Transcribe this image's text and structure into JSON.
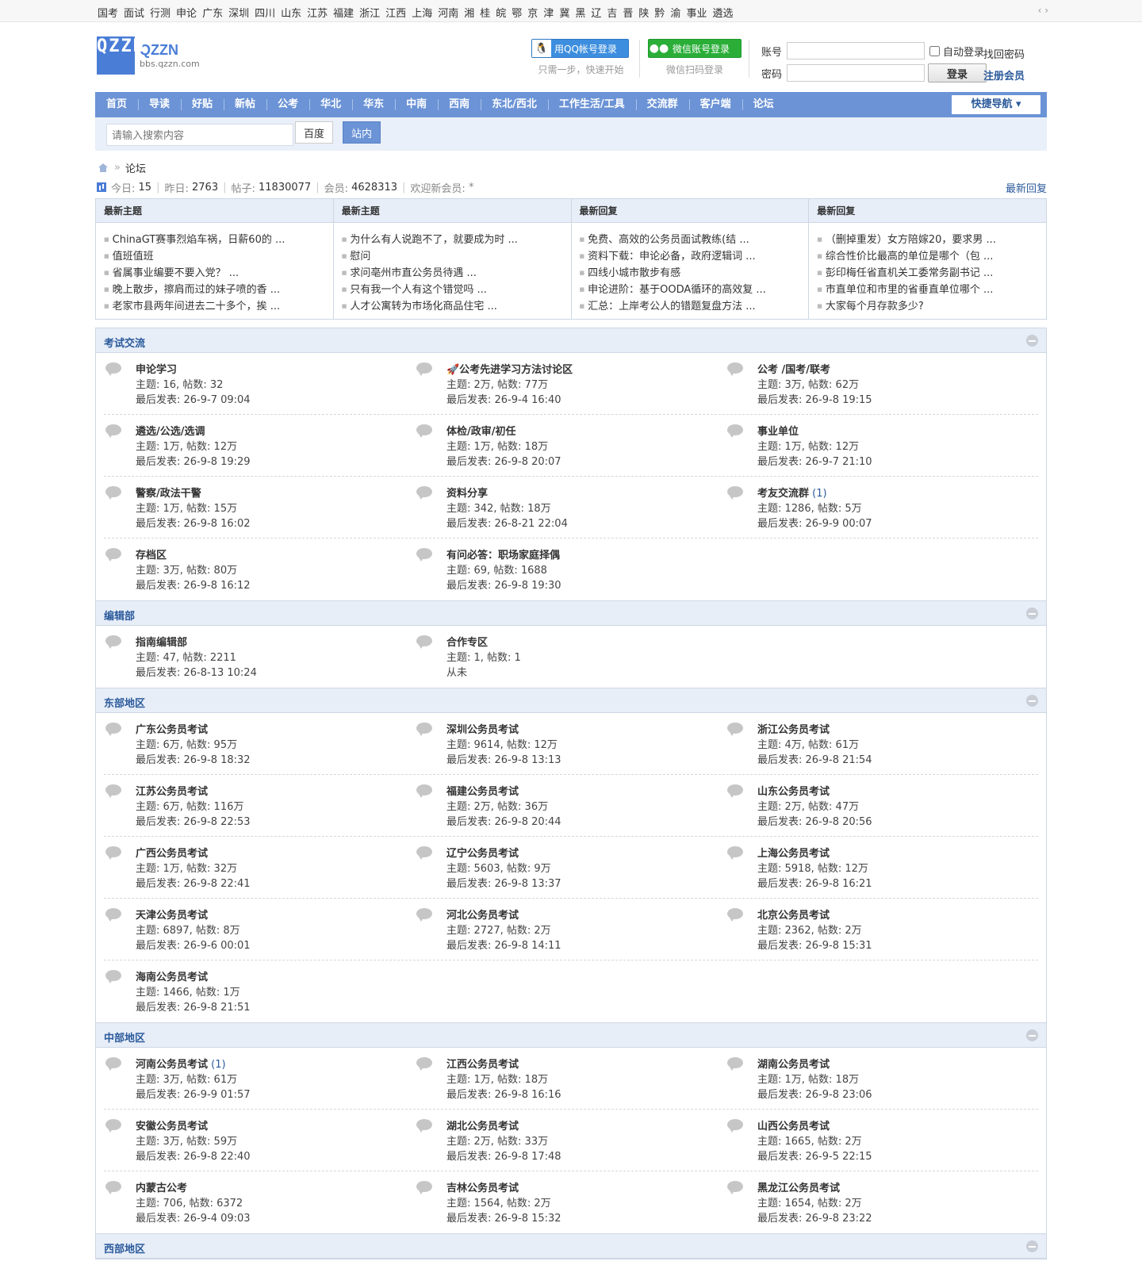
{
  "topbar": {
    "regions": [
      "国考",
      "面试",
      "行测",
      "申论",
      "广东",
      "深圳",
      "四川",
      "山东",
      "江苏",
      "福建",
      "浙江",
      "江西",
      "上海",
      "河南",
      "湘",
      "桂",
      "皖",
      "鄂",
      "京",
      "津",
      "冀",
      "黑",
      "辽",
      "吉",
      "晋",
      "陕",
      "黔",
      "渝",
      "事业",
      "遴选"
    ],
    "arrows": "‹ ›"
  },
  "header": {
    "logo_mark": "QZZN",
    "logo_title": "QZZN",
    "logo_url": "bbs.qzzn.com",
    "qq_button": "用QQ帐号登录",
    "qq_sub": "只需一步，快速开始",
    "wx_button": "微信账号登录",
    "wx_sub": "微信扫码登录",
    "account_label": "账号",
    "password_label": "密码",
    "auto_login": "自动登录",
    "login_button": "登录",
    "find_password": "找回密码",
    "register": "注册会员"
  },
  "nav": {
    "items": [
      "首页",
      "导读",
      "好贴",
      "新帖",
      "公考",
      "华北",
      "华东",
      "中南",
      "西南",
      "东北/西北",
      "工作生活/工具",
      "交流群",
      "客户端",
      "论坛"
    ],
    "quick_nav": "快捷导航"
  },
  "search": {
    "placeholder": "请输入搜索内容",
    "baidu": "百度",
    "site": "站内"
  },
  "breadcrumb": {
    "current": "论坛"
  },
  "stats": {
    "today_label": "今日:",
    "today": "15",
    "yesterday_label": "昨日:",
    "yesterday": "2763",
    "posts_label": "帖子:",
    "posts": "11830077",
    "members_label": "会员:",
    "members": "4628313",
    "welcome_label": "欢迎新会员:",
    "welcome": "*",
    "latest_reply": "最新回复"
  },
  "hot": [
    {
      "title": "最新主题",
      "items": [
        "ChinaGT赛事烈焰车祸，日薪60的 ...",
        "值班值班",
        "省属事业编要不要入党？ ...",
        "晚上散步，擦肩而过的妹子喷的香 ...",
        "老家市县两年间进去二十多个，挨 ..."
      ]
    },
    {
      "title": "最新主题",
      "items": [
        "为什么有人说跑不了，就要成为时 ...",
        "慰问",
        "求问亳州市直公务员待遇 ...",
        "只有我一个人有这个错觉吗 ...",
        "人才公寓转为市场化商品住宅 ..."
      ]
    },
    {
      "title": "最新回复",
      "items": [
        "免费、高效的公务员面试教练(结 ...",
        "资料下载：申论必备，政府逻辑词 ...",
        "四线小城市散步有感",
        "申论进阶：基于OODA循环的高效复 ...",
        "汇总：上岸考公人的错题复盘方法 ..."
      ]
    },
    {
      "title": "最新回复",
      "items": [
        "（删掉重发）女方陪嫁20，要求男 ...",
        "综合性价比最高的单位是哪个（包 ...",
        "彭印梅任省直机关工委常务副书记 ...",
        "市直单位和市里的省垂直单位哪个 ...",
        "大家每个月存款多少?"
      ]
    }
  ],
  "groups": [
    {
      "title": "考试交流",
      "rows": [
        [
          {
            "name": "申论学习",
            "count": "",
            "topics": "主题: 16, 帖数: 32",
            "last": "最后发表: 26-9-7 09:04"
          },
          {
            "name": "🚀公考先进学习方法讨论区",
            "count": "",
            "topics": "主题: 2万, 帖数: 77万",
            "last": "最后发表: 26-9-4 16:40"
          },
          {
            "name": "公考 /国考/联考",
            "count": "",
            "topics": "主题: 3万, 帖数: 62万",
            "last": "最后发表: 26-9-8 19:15"
          }
        ],
        [
          {
            "name": "遴选/公选/选调",
            "count": "",
            "topics": "主题: 1万, 帖数: 12万",
            "last": "最后发表: 26-9-8 19:29"
          },
          {
            "name": "体检/政审/初任",
            "count": "",
            "topics": "主题: 1万, 帖数: 18万",
            "last": "最后发表: 26-9-8 20:07"
          },
          {
            "name": "事业单位",
            "count": "",
            "topics": "主题: 1万, 帖数: 12万",
            "last": "最后发表: 26-9-7 21:10"
          }
        ],
        [
          {
            "name": "警察/政法干警",
            "count": "",
            "topics": "主题: 1万, 帖数: 15万",
            "last": "最后发表: 26-9-8 16:02"
          },
          {
            "name": "资料分享",
            "count": "",
            "topics": "主题: 342, 帖数: 18万",
            "last": "最后发表: 26-8-21 22:04"
          },
          {
            "name": "考友交流群",
            "count": "(1)",
            "topics": "主题: 1286, 帖数: 5万",
            "last": "最后发表: 26-9-9 00:07"
          }
        ],
        [
          {
            "name": "存档区",
            "count": "",
            "topics": "主题: 3万, 帖数: 80万",
            "last": "最后发表: 26-9-8 16:12"
          },
          {
            "name": "有问必答：职场家庭择偶",
            "count": "",
            "topics": "主题: 69, 帖数: 1688",
            "last": "最后发表: 26-9-8 19:30"
          }
        ]
      ]
    },
    {
      "title": "编辑部",
      "rows": [
        [
          {
            "name": "指南编辑部",
            "count": "",
            "topics": "主题: 47, 帖数: 2211",
            "last": "最后发表: 26-8-13 10:24"
          },
          {
            "name": "合作专区",
            "count": "",
            "topics": "主题: 1, 帖数: 1",
            "last": "从未"
          }
        ]
      ]
    },
    {
      "title": "东部地区",
      "rows": [
        [
          {
            "name": "广东公务员考试",
            "count": "",
            "topics": "主题: 6万, 帖数: 95万",
            "last": "最后发表: 26-9-8 18:32"
          },
          {
            "name": "深圳公务员考试",
            "count": "",
            "topics": "主题: 9614, 帖数: 12万",
            "last": "最后发表: 26-9-8 13:13"
          },
          {
            "name": "浙江公务员考试",
            "count": "",
            "topics": "主题: 4万, 帖数: 61万",
            "last": "最后发表: 26-9-8 21:54"
          }
        ],
        [
          {
            "name": "江苏公务员考试",
            "count": "",
            "topics": "主题: 6万, 帖数: 116万",
            "last": "最后发表: 26-9-8 22:53"
          },
          {
            "name": "福建公务员考试",
            "count": "",
            "topics": "主题: 2万, 帖数: 36万",
            "last": "最后发表: 26-9-8 20:44"
          },
          {
            "name": "山东公务员考试",
            "count": "",
            "topics": "主题: 2万, 帖数: 47万",
            "last": "最后发表: 26-9-8 20:56"
          }
        ],
        [
          {
            "name": "广西公务员考试",
            "count": "",
            "topics": "主题: 1万, 帖数: 32万",
            "last": "最后发表: 26-9-8 22:41"
          },
          {
            "name": "辽宁公务员考试",
            "count": "",
            "topics": "主题: 5603, 帖数: 9万",
            "last": "最后发表: 26-9-8 13:37"
          },
          {
            "name": "上海公务员考试",
            "count": "",
            "topics": "主题: 5918, 帖数: 12万",
            "last": "最后发表: 26-9-8 16:21"
          }
        ],
        [
          {
            "name": "天津公务员考试",
            "count": "",
            "topics": "主题: 6897, 帖数: 8万",
            "last": "最后发表: 26-9-6 00:01"
          },
          {
            "name": "河北公务员考试",
            "count": "",
            "topics": "主题: 2727, 帖数: 2万",
            "last": "最后发表: 26-9-8 14:11"
          },
          {
            "name": "北京公务员考试",
            "count": "",
            "topics": "主题: 2362, 帖数: 2万",
            "last": "最后发表: 26-9-8 15:31"
          }
        ],
        [
          {
            "name": "海南公务员考试",
            "count": "",
            "topics": "主题: 1466, 帖数: 1万",
            "last": "最后发表: 26-9-8 21:51"
          }
        ]
      ]
    },
    {
      "title": "中部地区",
      "rows": [
        [
          {
            "name": "河南公务员考试",
            "count": "(1)",
            "topics": "主题: 3万, 帖数: 61万",
            "last": "最后发表: 26-9-9 01:57"
          },
          {
            "name": "江西公务员考试",
            "count": "",
            "topics": "主题: 1万, 帖数: 18万",
            "last": "最后发表: 26-9-8 16:16"
          },
          {
            "name": "湖南公务员考试",
            "count": "",
            "topics": "主题: 1万, 帖数: 18万",
            "last": "最后发表: 26-9-8 23:06"
          }
        ],
        [
          {
            "name": "安徽公务员考试",
            "count": "",
            "topics": "主题: 3万, 帖数: 59万",
            "last": "最后发表: 26-9-8 22:40"
          },
          {
            "name": "湖北公务员考试",
            "count": "",
            "topics": "主题: 2万, 帖数: 33万",
            "last": "最后发表: 26-9-8 17:48"
          },
          {
            "name": "山西公务员考试",
            "count": "",
            "topics": "主题: 1665, 帖数: 2万",
            "last": "最后发表: 26-9-5 22:15"
          }
        ],
        [
          {
            "name": "内蒙古公考",
            "count": "",
            "topics": "主题: 706, 帖数: 6372",
            "last": "最后发表: 26-9-4 09:03"
          },
          {
            "name": "吉林公务员考试",
            "count": "",
            "topics": "主题: 1564, 帖数: 2万",
            "last": "最后发表: 26-9-8 15:32"
          },
          {
            "name": "黑龙江公务员考试",
            "count": "",
            "topics": "主题: 1654, 帖数: 2万",
            "last": "最后发表: 26-9-8 23:22"
          }
        ]
      ]
    },
    {
      "title": "西部地区",
      "rows": []
    }
  ]
}
